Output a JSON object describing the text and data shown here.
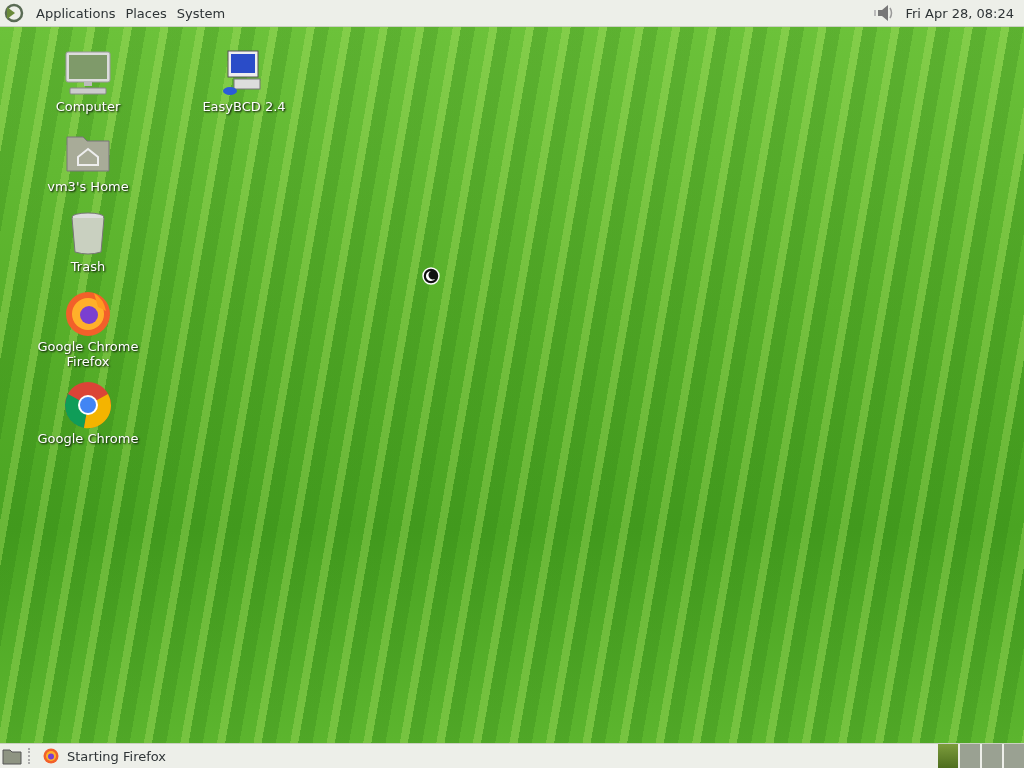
{
  "top_panel": {
    "menus": [
      {
        "label": "Applications"
      },
      {
        "label": "Places"
      },
      {
        "label": "System"
      }
    ],
    "clock": "Fri Apr 28, 08:24"
  },
  "desktop": {
    "columns": [
      [
        {
          "kind": "computer",
          "labels": [
            "Computer"
          ]
        },
        {
          "kind": "home",
          "labels": [
            "vm3's Home"
          ]
        },
        {
          "kind": "trash",
          "labels": [
            "Trash"
          ]
        },
        {
          "kind": "firefox",
          "labels": [
            "Google Chrome",
            "Firefox"
          ]
        },
        {
          "kind": "chrome",
          "labels": [
            "Google Chrome"
          ]
        }
      ],
      [
        {
          "kind": "easybcd",
          "labels": [
            "EasyBCD 2.4"
          ]
        }
      ]
    ]
  },
  "bottom_panel": {
    "task": {
      "label": "Starting Firefox"
    },
    "workspaces": [
      {
        "selected": true
      },
      {
        "selected": false
      },
      {
        "selected": false
      },
      {
        "selected": false
      }
    ]
  }
}
